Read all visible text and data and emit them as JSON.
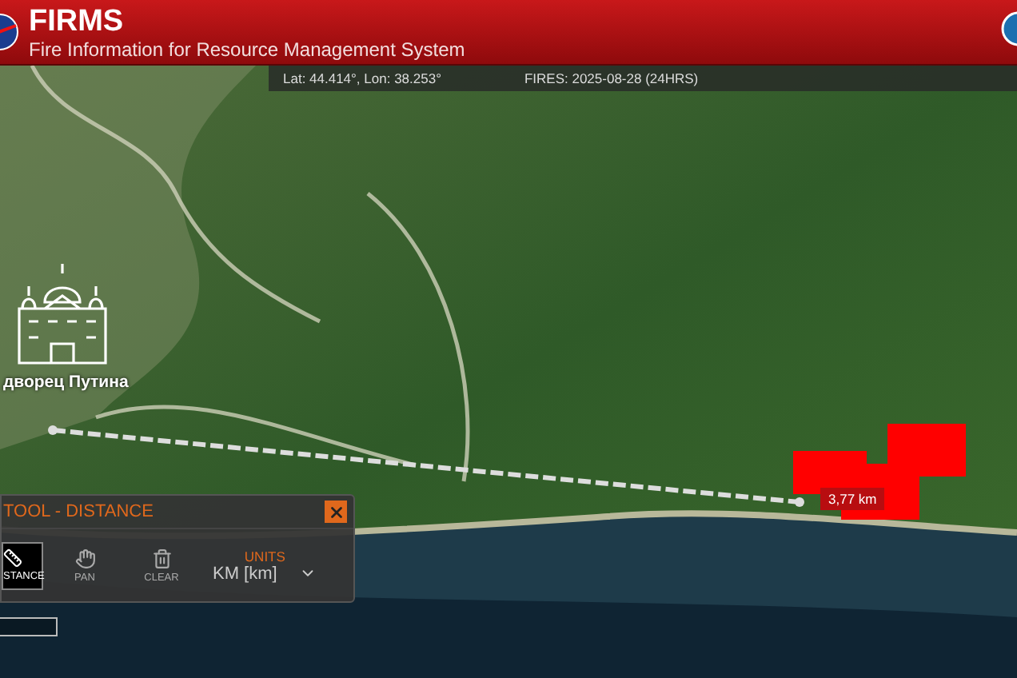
{
  "header": {
    "title": "FIRMS",
    "subtitle": "Fire Information for Resource Management System"
  },
  "status_bar": {
    "coordinates": "Lat: 44.414°, Lon: 38.253°",
    "fires": "FIRES: 2025-08-28 (24HRS)"
  },
  "map": {
    "landmark": "дворец Путина",
    "measurement": "3,77 km"
  },
  "tool_panel": {
    "title": "TOOL - DISTANCE",
    "tools": [
      {
        "kind": "distance",
        "label": "STANCE",
        "selected": true
      },
      {
        "kind": "pan",
        "label": "PAN",
        "selected": false
      },
      {
        "kind": "clear",
        "label": "CLEAR",
        "selected": false
      }
    ],
    "units_label": "UNITS",
    "units_value": "KM [km]"
  }
}
